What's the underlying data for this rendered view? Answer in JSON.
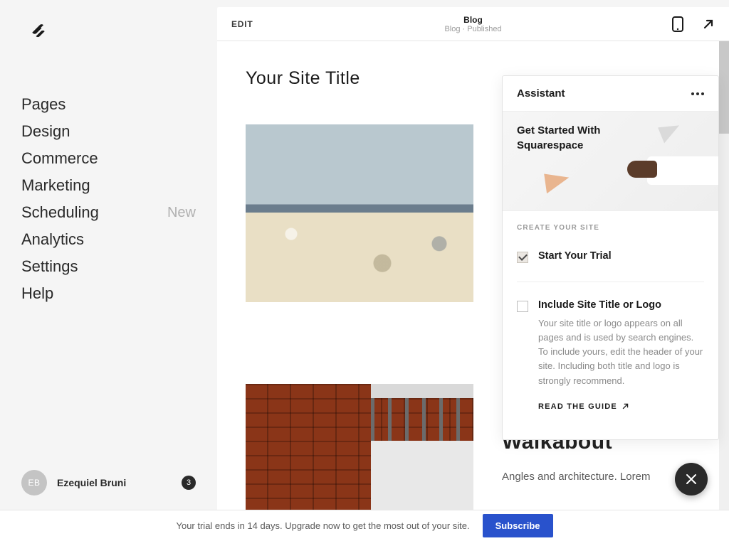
{
  "sidebar": {
    "items": [
      {
        "label": "Pages",
        "badge": ""
      },
      {
        "label": "Design",
        "badge": ""
      },
      {
        "label": "Commerce",
        "badge": ""
      },
      {
        "label": "Marketing",
        "badge": ""
      },
      {
        "label": "Scheduling",
        "badge": "New"
      },
      {
        "label": "Analytics",
        "badge": ""
      },
      {
        "label": "Settings",
        "badge": ""
      },
      {
        "label": "Help",
        "badge": ""
      }
    ],
    "user": {
      "initials": "EB",
      "name": "Ezequiel Bruni",
      "notification_count": "3"
    }
  },
  "editor_header": {
    "edit_label": "EDIT",
    "title": "Blog",
    "subtitle": "Blog · Published"
  },
  "site": {
    "title": "Your Site Title",
    "post_title": "Walkabout",
    "post_excerpt": "Angles and architecture. Lorem"
  },
  "assistant": {
    "title": "Assistant",
    "hero_title": "Get Started With Squarespace",
    "section_label": "CREATE YOUR SITE",
    "items": [
      {
        "checked": true,
        "title": "Start Your Trial",
        "desc": "",
        "guide": ""
      },
      {
        "checked": false,
        "title": "Include Site Title or Logo",
        "desc": "Your site title or logo appears on all pages and is used by search engines. To include yours, edit the header of your site. Including both title and logo is strongly recommend.",
        "guide": "READ THE GUIDE"
      }
    ]
  },
  "trial_bar": {
    "message": "Your trial ends in 14 days. Upgrade now to get the most out of your site.",
    "button": "Subscribe"
  }
}
